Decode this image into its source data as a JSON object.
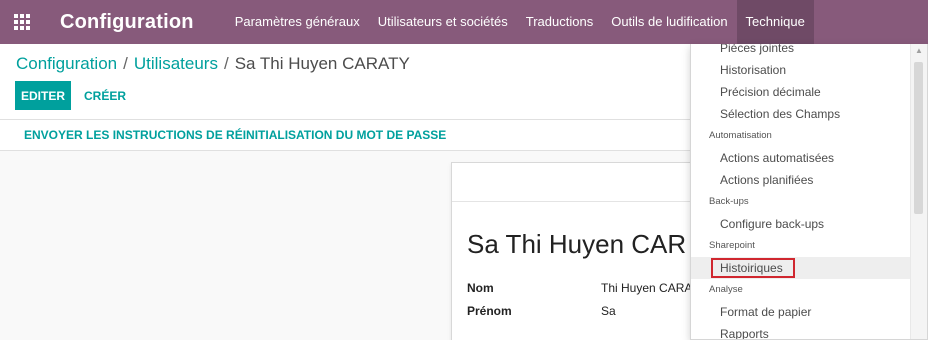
{
  "topbar": {
    "app_icon": "apps-grid-icon",
    "brand": "Configuration",
    "menu": [
      {
        "label": "Paramètres généraux"
      },
      {
        "label": "Utilisateurs et sociétés"
      },
      {
        "label": "Traductions"
      },
      {
        "label": "Outils de ludification"
      },
      {
        "label": "Technique"
      }
    ],
    "active_index": 4
  },
  "breadcrumb": {
    "crumb1": "Configuration",
    "crumb2": "Utilisateurs",
    "current": "Sa Thi Huyen CARATY",
    "separator": "/"
  },
  "buttons": {
    "edit": "EDITER",
    "create": "CRÉER",
    "reset_password": "ENVOYER LES INSTRUCTIONS DE RÉINITIALISATION DU MOT DE PASSE"
  },
  "form": {
    "title": "Sa Thi Huyen CAR",
    "fields": [
      {
        "label": "Nom",
        "value": "Thi Huyen CARATY"
      },
      {
        "label": "Prénom",
        "value": "Sa"
      }
    ]
  },
  "dropdown": {
    "entries": [
      {
        "kind": "item",
        "label": "Pièces jointes"
      },
      {
        "kind": "item",
        "label": "Historisation"
      },
      {
        "kind": "item",
        "label": "Précision décimale"
      },
      {
        "kind": "item",
        "label": "Sélection des Champs"
      },
      {
        "kind": "header",
        "label": "Automatisation"
      },
      {
        "kind": "item",
        "label": "Actions automatisées"
      },
      {
        "kind": "item",
        "label": "Actions planifiées"
      },
      {
        "kind": "header",
        "label": "Back-ups"
      },
      {
        "kind": "item",
        "label": "Configure back-ups"
      },
      {
        "kind": "header",
        "label": "Sharepoint"
      },
      {
        "kind": "item",
        "label": "Histoiriques",
        "highlighted": true
      },
      {
        "kind": "header",
        "label": "Analyse"
      },
      {
        "kind": "item",
        "label": "Format de papier"
      },
      {
        "kind": "item",
        "label": "Rapports"
      }
    ]
  },
  "colors": {
    "brand_purple": "#875a7b",
    "active_menu": "#6f4a66",
    "accent_teal": "#00a09d",
    "highlight_border": "#d0272f"
  }
}
